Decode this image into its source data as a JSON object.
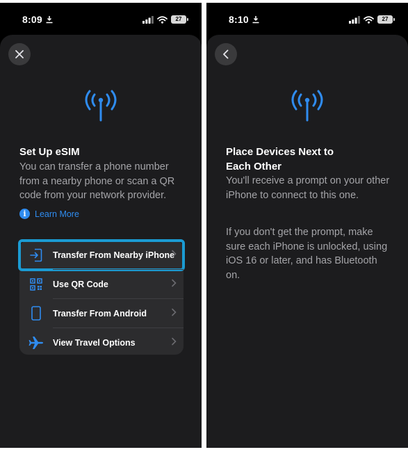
{
  "left_screen": {
    "status_bar": {
      "time": "8:09",
      "battery": "27"
    },
    "nav": {
      "icon": "close-icon"
    },
    "title": "Set Up eSIM",
    "description": "You can transfer a phone number from a nearby phone or scan a QR code from your network provider.",
    "learn_more": {
      "icon": "info-icon",
      "label": "Learn More"
    },
    "options": [
      {
        "icon": "transfer-icon",
        "label": "Transfer From Nearby iPhone",
        "highlighted": true
      },
      {
        "icon": "qr-code-icon",
        "label": "Use QR Code"
      },
      {
        "icon": "phone-icon",
        "label": "Transfer From Android"
      },
      {
        "icon": "airplane-icon",
        "label": "View Travel Options"
      }
    ]
  },
  "right_screen": {
    "status_bar": {
      "time": "8:10",
      "battery": "27"
    },
    "nav": {
      "icon": "back-icon"
    },
    "title": "Place Devices Next to Each Other",
    "paragraph_1": "You'll receive a prompt on your other iPhone to connect to this one.",
    "paragraph_2": "If you don't get the prompt, make sure each iPhone is unlocked, using iOS 16 or later, and has Bluetooth on."
  },
  "colors": {
    "accent": "#2f8cf0",
    "highlight": "#1b9bd3",
    "sheet": "#1c1c1e",
    "card": "#2c2c2e"
  }
}
